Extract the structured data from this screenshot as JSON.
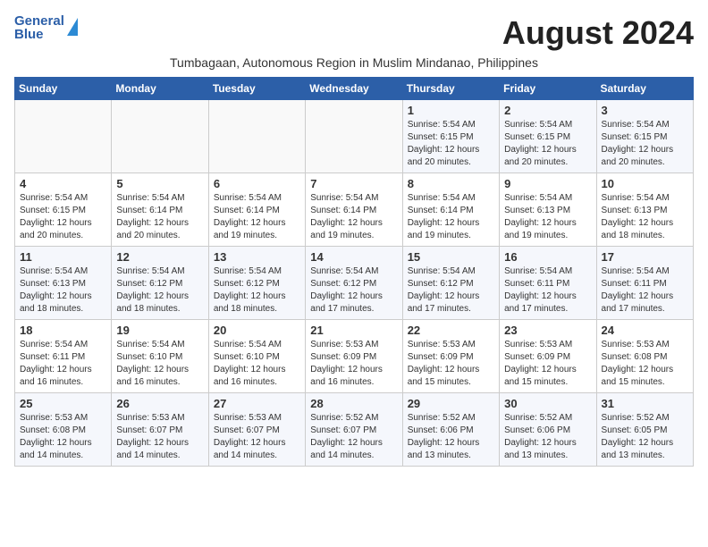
{
  "header": {
    "logo_general": "General",
    "logo_blue": "Blue",
    "month_title": "August 2024",
    "subtitle": "Tumbagaan, Autonomous Region in Muslim Mindanao, Philippines"
  },
  "weekdays": [
    "Sunday",
    "Monday",
    "Tuesday",
    "Wednesday",
    "Thursday",
    "Friday",
    "Saturday"
  ],
  "weeks": [
    [
      {
        "day": "",
        "info": ""
      },
      {
        "day": "",
        "info": ""
      },
      {
        "day": "",
        "info": ""
      },
      {
        "day": "",
        "info": ""
      },
      {
        "day": "1",
        "info": "Sunrise: 5:54 AM\nSunset: 6:15 PM\nDaylight: 12 hours\nand 20 minutes."
      },
      {
        "day": "2",
        "info": "Sunrise: 5:54 AM\nSunset: 6:15 PM\nDaylight: 12 hours\nand 20 minutes."
      },
      {
        "day": "3",
        "info": "Sunrise: 5:54 AM\nSunset: 6:15 PM\nDaylight: 12 hours\nand 20 minutes."
      }
    ],
    [
      {
        "day": "4",
        "info": "Sunrise: 5:54 AM\nSunset: 6:15 PM\nDaylight: 12 hours\nand 20 minutes."
      },
      {
        "day": "5",
        "info": "Sunrise: 5:54 AM\nSunset: 6:14 PM\nDaylight: 12 hours\nand 20 minutes."
      },
      {
        "day": "6",
        "info": "Sunrise: 5:54 AM\nSunset: 6:14 PM\nDaylight: 12 hours\nand 19 minutes."
      },
      {
        "day": "7",
        "info": "Sunrise: 5:54 AM\nSunset: 6:14 PM\nDaylight: 12 hours\nand 19 minutes."
      },
      {
        "day": "8",
        "info": "Sunrise: 5:54 AM\nSunset: 6:14 PM\nDaylight: 12 hours\nand 19 minutes."
      },
      {
        "day": "9",
        "info": "Sunrise: 5:54 AM\nSunset: 6:13 PM\nDaylight: 12 hours\nand 19 minutes."
      },
      {
        "day": "10",
        "info": "Sunrise: 5:54 AM\nSunset: 6:13 PM\nDaylight: 12 hours\nand 18 minutes."
      }
    ],
    [
      {
        "day": "11",
        "info": "Sunrise: 5:54 AM\nSunset: 6:13 PM\nDaylight: 12 hours\nand 18 minutes."
      },
      {
        "day": "12",
        "info": "Sunrise: 5:54 AM\nSunset: 6:12 PM\nDaylight: 12 hours\nand 18 minutes."
      },
      {
        "day": "13",
        "info": "Sunrise: 5:54 AM\nSunset: 6:12 PM\nDaylight: 12 hours\nand 18 minutes."
      },
      {
        "day": "14",
        "info": "Sunrise: 5:54 AM\nSunset: 6:12 PM\nDaylight: 12 hours\nand 17 minutes."
      },
      {
        "day": "15",
        "info": "Sunrise: 5:54 AM\nSunset: 6:12 PM\nDaylight: 12 hours\nand 17 minutes."
      },
      {
        "day": "16",
        "info": "Sunrise: 5:54 AM\nSunset: 6:11 PM\nDaylight: 12 hours\nand 17 minutes."
      },
      {
        "day": "17",
        "info": "Sunrise: 5:54 AM\nSunset: 6:11 PM\nDaylight: 12 hours\nand 17 minutes."
      }
    ],
    [
      {
        "day": "18",
        "info": "Sunrise: 5:54 AM\nSunset: 6:11 PM\nDaylight: 12 hours\nand 16 minutes."
      },
      {
        "day": "19",
        "info": "Sunrise: 5:54 AM\nSunset: 6:10 PM\nDaylight: 12 hours\nand 16 minutes."
      },
      {
        "day": "20",
        "info": "Sunrise: 5:54 AM\nSunset: 6:10 PM\nDaylight: 12 hours\nand 16 minutes."
      },
      {
        "day": "21",
        "info": "Sunrise: 5:53 AM\nSunset: 6:09 PM\nDaylight: 12 hours\nand 16 minutes."
      },
      {
        "day": "22",
        "info": "Sunrise: 5:53 AM\nSunset: 6:09 PM\nDaylight: 12 hours\nand 15 minutes."
      },
      {
        "day": "23",
        "info": "Sunrise: 5:53 AM\nSunset: 6:09 PM\nDaylight: 12 hours\nand 15 minutes."
      },
      {
        "day": "24",
        "info": "Sunrise: 5:53 AM\nSunset: 6:08 PM\nDaylight: 12 hours\nand 15 minutes."
      }
    ],
    [
      {
        "day": "25",
        "info": "Sunrise: 5:53 AM\nSunset: 6:08 PM\nDaylight: 12 hours\nand 14 minutes."
      },
      {
        "day": "26",
        "info": "Sunrise: 5:53 AM\nSunset: 6:07 PM\nDaylight: 12 hours\nand 14 minutes."
      },
      {
        "day": "27",
        "info": "Sunrise: 5:53 AM\nSunset: 6:07 PM\nDaylight: 12 hours\nand 14 minutes."
      },
      {
        "day": "28",
        "info": "Sunrise: 5:52 AM\nSunset: 6:07 PM\nDaylight: 12 hours\nand 14 minutes."
      },
      {
        "day": "29",
        "info": "Sunrise: 5:52 AM\nSunset: 6:06 PM\nDaylight: 12 hours\nand 13 minutes."
      },
      {
        "day": "30",
        "info": "Sunrise: 5:52 AM\nSunset: 6:06 PM\nDaylight: 12 hours\nand 13 minutes."
      },
      {
        "day": "31",
        "info": "Sunrise: 5:52 AM\nSunset: 6:05 PM\nDaylight: 12 hours\nand 13 minutes."
      }
    ]
  ]
}
